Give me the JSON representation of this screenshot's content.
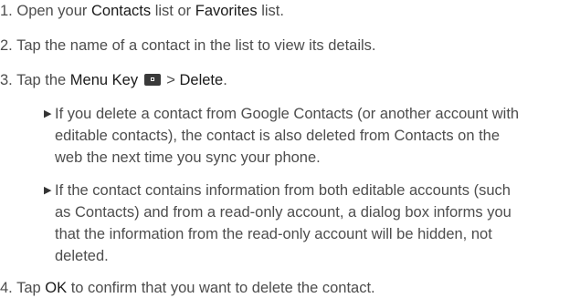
{
  "steps": [
    {
      "number": "1.",
      "pre": "Open your",
      "bold1": "Contacts",
      "mid": "list or",
      "bold2": "Favorites",
      "post": "list."
    },
    {
      "number": "2.",
      "text": "Tap the name of a contact in the list to view its details."
    },
    {
      "number": "3.",
      "pre": "Tap the",
      "bold1": "Menu Key",
      "icon": "menu-key-icon",
      "mid": ">",
      "bold2": "Delete",
      "post": "."
    },
    {
      "number": "4.",
      "pre": "Tap",
      "bold1": "OK",
      "post": "to confirm that you want to delete the contact."
    }
  ],
  "bullets": [
    {
      "marker": "▶",
      "lines": [
        "If you delete a contact from Google Contacts (or another account with",
        "editable contacts), the contact is also deleted from Contacts on the",
        "web the next time you sync your phone."
      ]
    },
    {
      "marker": "▶",
      "lines": [
        "If the contact contains information from both editable accounts (such",
        "as Contacts) and from a read-only account, a dialog box informs you",
        "that the information from the read-only account will be hidden, not",
        "deleted."
      ]
    }
  ]
}
